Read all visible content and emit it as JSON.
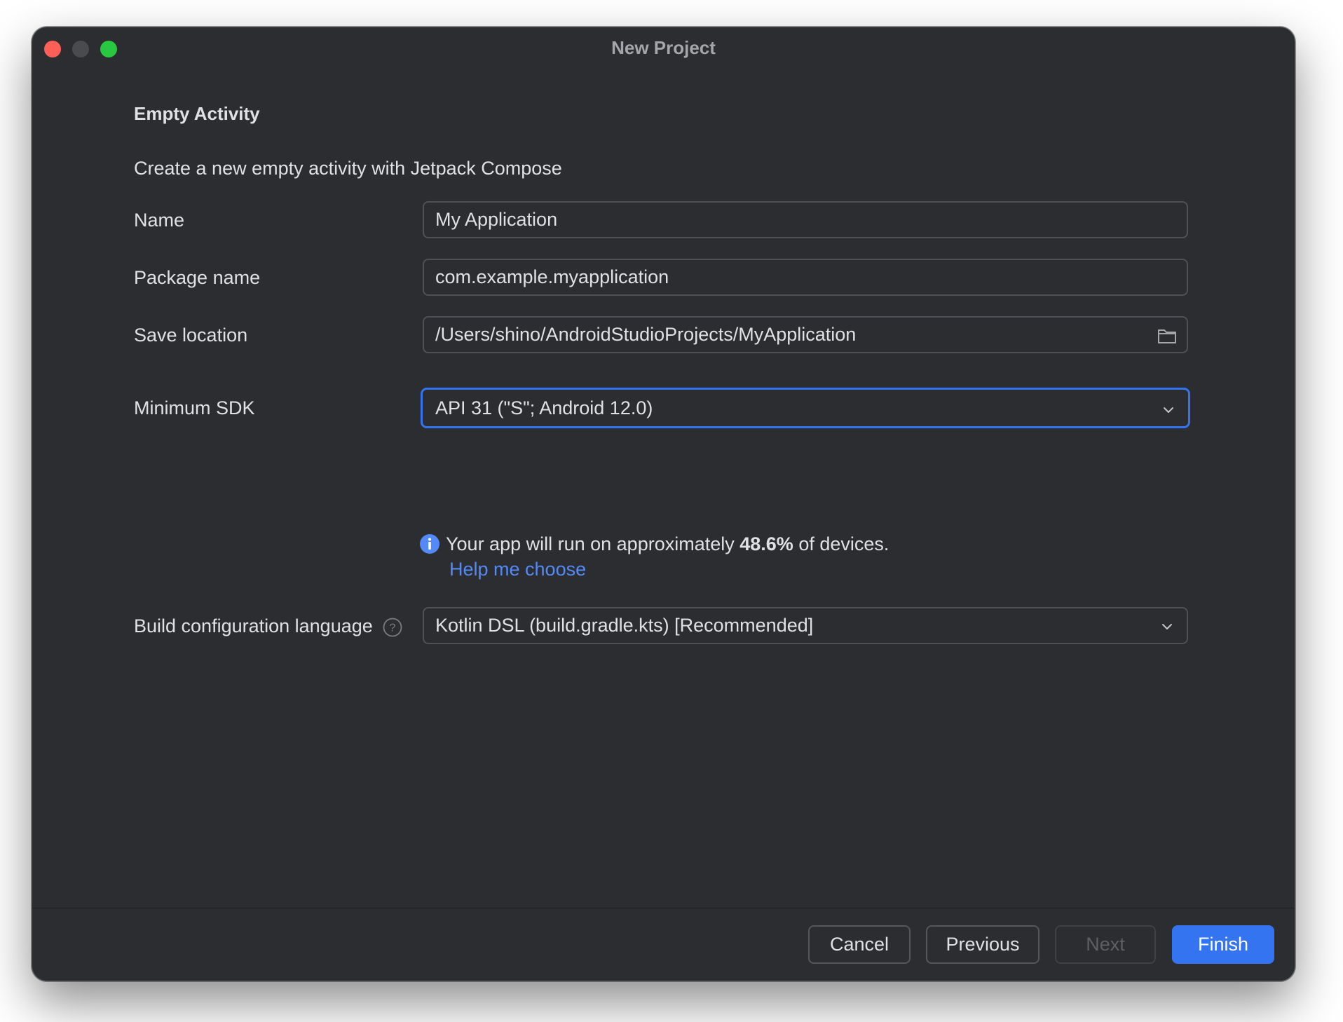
{
  "window": {
    "title": "New Project"
  },
  "header": {
    "title": "Empty Activity",
    "description": "Create a new empty activity with Jetpack Compose"
  },
  "form": {
    "name": {
      "label": "Name",
      "value": "My Application"
    },
    "package": {
      "label": "Package name",
      "value": "com.example.myapplication"
    },
    "location": {
      "label": "Save location",
      "value": "/Users/shino/AndroidStudioProjects/MyApplication",
      "icon": "folder-icon"
    },
    "min_sdk": {
      "label": "Minimum SDK",
      "value": "API 31 (\"S\"; Android 12.0)",
      "icon": "chevron-down-icon"
    },
    "sdk_info": {
      "prefix": "Your app will run on approximately ",
      "percent": "48.6%",
      "suffix": " of devices.",
      "help_link": "Help me choose"
    },
    "build_lang": {
      "label": "Build configuration language",
      "value": "Kotlin DSL (build.gradle.kts) [Recommended]",
      "icon": "chevron-down-icon"
    }
  },
  "footer": {
    "cancel": "Cancel",
    "previous": "Previous",
    "next": "Next",
    "finish": "Finish"
  },
  "colors": {
    "background": "#2b2d30",
    "accent": "#3574f0",
    "link": "#548af7",
    "text": "#dfe1e5"
  }
}
